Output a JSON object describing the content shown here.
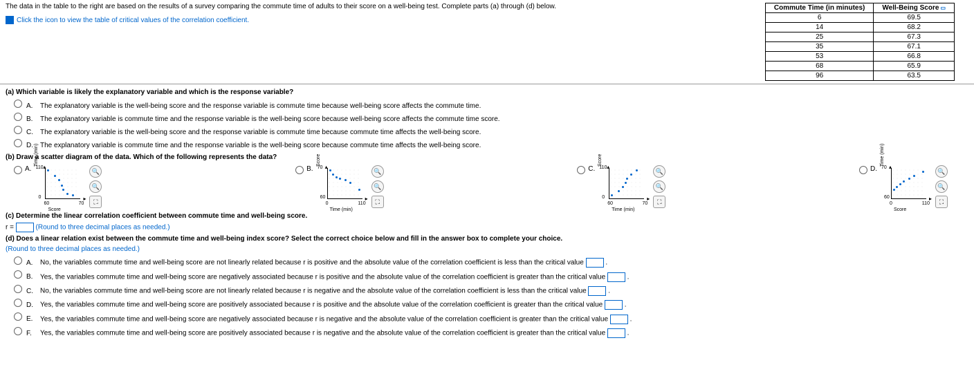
{
  "intro": "The data in the table to the right are based on the results of a survey comparing the commute time of adults to their score on a well-being test. Complete parts (a) through (d) below.",
  "link_text": "Click the icon to view the table of critical values of the correlation coefficient.",
  "table": {
    "h1": "Commute Time (in minutes)",
    "h2": "Well-Being Score",
    "rows": [
      {
        "c": "6",
        "s": "69.5"
      },
      {
        "c": "14",
        "s": "68.2"
      },
      {
        "c": "25",
        "s": "67.3"
      },
      {
        "c": "35",
        "s": "67.1"
      },
      {
        "c": "53",
        "s": "66.8"
      },
      {
        "c": "68",
        "s": "65.9"
      },
      {
        "c": "96",
        "s": "63.5"
      }
    ]
  },
  "qa": {
    "text": "(a) Which variable is likely the explanatory variable and which is the response variable?",
    "A": "The explanatory variable is the well-being score and the response variable is commute time because well-being score affects the commute time.",
    "B": "The explanatory variable is commute time and the response variable is the well-being score because well-being score affects the commute time score.",
    "C": "The explanatory variable is the well-being score and the response variable is commute time because commute time affects the well-being score.",
    "D": "The explanatory variable is commute time and the response variable is the well-being score because commute time affects the well-being score."
  },
  "qb": {
    "text": "(b) Draw a scatter diagram of the data. Which of the following represents the data?",
    "labels": {
      "A": "A.",
      "B": "B.",
      "C": "C.",
      "D": "D."
    },
    "A": {
      "ylab": "Time (min)",
      "xlab": "Score",
      "y1": "110",
      "y2": "0",
      "x1": "60",
      "x2": "70"
    },
    "B": {
      "ylab": "Score",
      "xlab": "Time (min)",
      "y1": "70",
      "y2": "60",
      "x1": "0",
      "x2": "110"
    },
    "C": {
      "ylab": "Score",
      "xlab": "Time (min)",
      "y1": "110",
      "y2": "0",
      "x1": "60",
      "x2": "70"
    },
    "D": {
      "ylab": "Time (min)",
      "xlab": "Score",
      "y1": "70",
      "y2": "60",
      "x1": "0",
      "x2": "110"
    }
  },
  "qc": {
    "text": "(c) Determine the linear correlation coefficient between commute time and well-being score.",
    "input": "r = ",
    "hint": "(Round to three decimal places as needed.)"
  },
  "qd": {
    "text": "(d) Does a linear relation exist between the commute time and well-being index score? Select the correct choice below and fill in the answer box to complete your choice.",
    "hint": "(Round to three decimal places as needed.)",
    "A": "No, the variables commute time and well-being score are not linearly related because r is positive and the absolute value of the correlation coefficient is less than the critical value",
    "B": "Yes, the variables commute time and well-being score are negatively associated because r is positive and the absolute value of the correlation coefficient is greater than the critical value",
    "C": "No, the variables commute time and well-being score are not linearly related because r is negative and the absolute value of the correlation coefficient is less than the critical value",
    "D": "Yes, the variables commute time and well-being score are positively associated because r is positive and the absolute value of the correlation coefficient is greater than the critical value",
    "E": "Yes, the variables commute time and well-being score are negatively associated because r is negative and the absolute value of the correlation coefficient is greater than the critical value",
    "F": "Yes, the variables commute time and well-being score are positively associated because r is negative and the absolute value of the correlation coefficient is greater than the critical value"
  },
  "letters": {
    "A": "A.",
    "B": "B.",
    "C": "C.",
    "D": "D.",
    "E": "E.",
    "F": "F."
  }
}
